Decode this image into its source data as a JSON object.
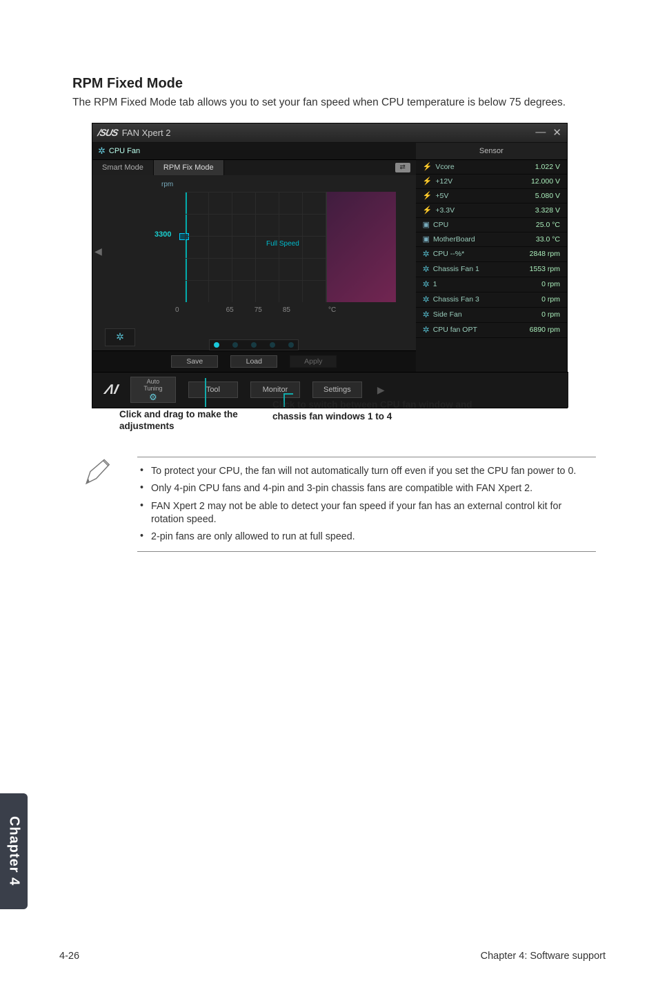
{
  "heading": "RPM Fixed Mode",
  "intro": "The RPM Fixed Mode tab allows you to set your fan speed when CPU temperature is below 75 degrees.",
  "window": {
    "app_title": "FAN Xpert 2",
    "cpu_tab": "CPU Fan",
    "mode_tabs": {
      "smart": "Smart Mode",
      "rpm_fix": "RPM Fix Mode"
    },
    "graph": {
      "rpm_label": "rpm",
      "current_rpm": "3300",
      "full_speed": "Full Speed",
      "x_ticks": [
        "0",
        "65",
        "75",
        "85"
      ],
      "unit": "°C"
    },
    "save_row": {
      "save": "Save",
      "load": "Load",
      "apply": "Apply"
    },
    "bottombar": {
      "auto_line1": "Auto",
      "auto_line2": "Tuning",
      "tool": "Tool",
      "monitor": "Monitor",
      "settings": "Settings"
    },
    "sensor": {
      "header": "Sensor",
      "rows": [
        {
          "icon": "bolt",
          "name": "Vcore",
          "value": "1.022 V"
        },
        {
          "icon": "bolt",
          "name": "+12V",
          "value": "12.000 V"
        },
        {
          "icon": "bolt",
          "name": "+5V",
          "value": "5.080 V"
        },
        {
          "icon": "bolt",
          "name": "+3.3V",
          "value": "3.328 V"
        },
        {
          "icon": "chip",
          "name": "CPU",
          "value": "25.0 °C"
        },
        {
          "icon": "chip",
          "name": "MotherBoard",
          "value": "33.0 °C"
        },
        {
          "icon": "fan",
          "name": "CPU --%*",
          "value": "2848 rpm"
        },
        {
          "icon": "fan",
          "name": "Chassis Fan 1",
          "value": "1553 rpm"
        },
        {
          "icon": "fan",
          "name": "1",
          "value": "0 rpm"
        },
        {
          "icon": "fan",
          "name": "Chassis Fan 3",
          "value": "0 rpm"
        },
        {
          "icon": "fan",
          "name": "Side Fan",
          "value": "0 rpm"
        },
        {
          "icon": "fan",
          "name": "CPU fan OPT",
          "value": "6890 rpm"
        }
      ]
    }
  },
  "callouts": {
    "left": "Click and drag to make the adjustments",
    "right": "Click to switch between CPU fan window and chassis fan windows 1 to 4"
  },
  "notes": [
    "To protect your CPU, the fan will not automatically turn off even if you set the CPU fan power to 0.",
    "Only 4-pin CPU fans and 4-pin and 3-pin chassis fans are compatible with FAN Xpert 2.",
    "FAN Xpert 2 may not be able to detect your fan speed if your fan has an external control kit for rotation speed.",
    "2-pin fans are only allowed to run at full speed."
  ],
  "chapter_tab": "Chapter 4",
  "footer": {
    "left": "4-26",
    "right": "Chapter 4: Software support"
  }
}
